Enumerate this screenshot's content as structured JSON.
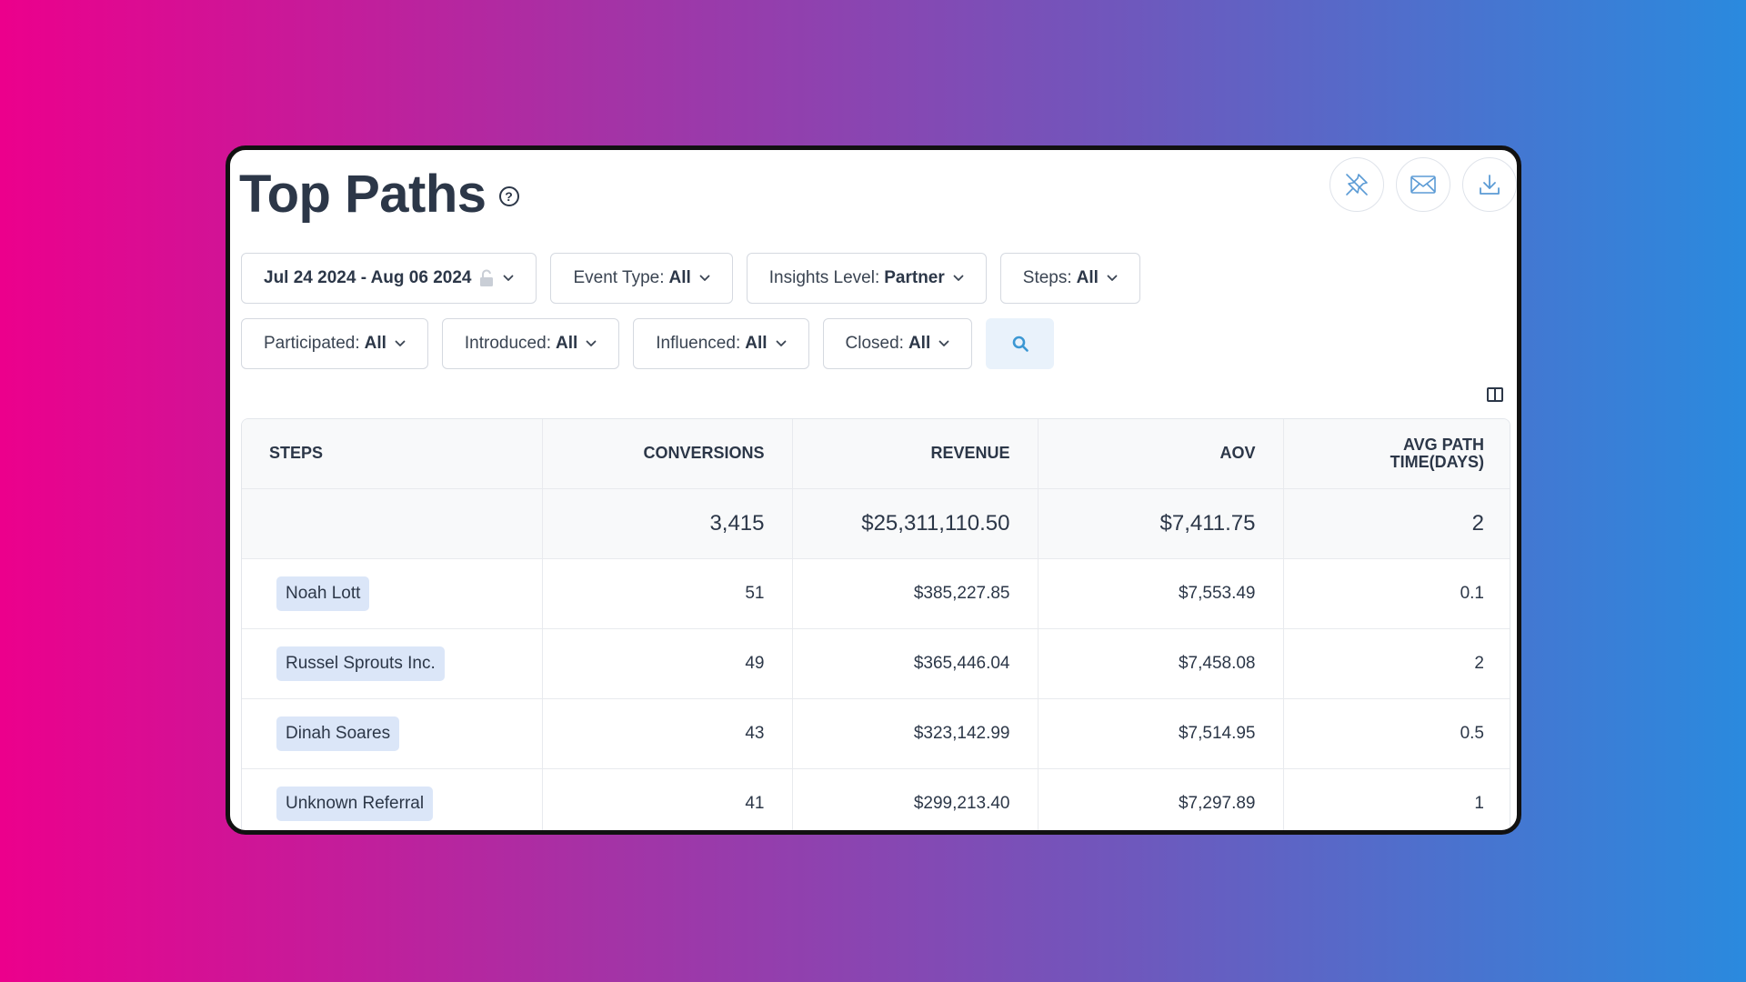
{
  "header": {
    "title": "Top Paths",
    "help_icon": "question-circle-icon",
    "actions": [
      {
        "icon": "pin-off-icon"
      },
      {
        "icon": "mail-icon"
      },
      {
        "icon": "download-icon"
      }
    ]
  },
  "filters": {
    "date_range": "Jul 24 2024 - Aug 06 2024",
    "event_type": {
      "label": "Event Type:",
      "value": "All"
    },
    "insights_level": {
      "label": "Insights Level:",
      "value": "Partner"
    },
    "steps": {
      "label": "Steps:",
      "value": "All"
    },
    "participated": {
      "label": "Participated:",
      "value": "All"
    },
    "introduced": {
      "label": "Introduced:",
      "value": "All"
    },
    "influenced": {
      "label": "Influenced:",
      "value": "All"
    },
    "closed": {
      "label": "Closed:",
      "value": "All"
    }
  },
  "table": {
    "columns": [
      "STEPS",
      "CONVERSIONS",
      "REVENUE",
      "AOV",
      "AVG PATH",
      "TIME(DAYS)"
    ],
    "totals": {
      "steps": "",
      "conversions": "3,415",
      "revenue": "$25,311,110.50",
      "aov": "$7,411.75",
      "avg_path_time": "2"
    },
    "rows": [
      {
        "step": "Noah Lott",
        "conversions": "51",
        "revenue": "$385,227.85",
        "aov": "$7,553.49",
        "avg_path_time": "0.1"
      },
      {
        "step": "Russel Sprouts Inc.",
        "conversions": "49",
        "revenue": "$365,446.04",
        "aov": "$7,458.08",
        "avg_path_time": "2"
      },
      {
        "step": "Dinah Soares",
        "conversions": "43",
        "revenue": "$323,142.99",
        "aov": "$7,514.95",
        "avg_path_time": "0.5"
      },
      {
        "step": "Unknown Referral",
        "conversions": "41",
        "revenue": "$299,213.40",
        "aov": "$7,297.89",
        "avg_path_time": "1"
      }
    ]
  },
  "colors": {
    "text": "#2c3748",
    "chip": "#dbe6f8",
    "accent": "#3b97d3",
    "border": "#d5d9e0"
  }
}
